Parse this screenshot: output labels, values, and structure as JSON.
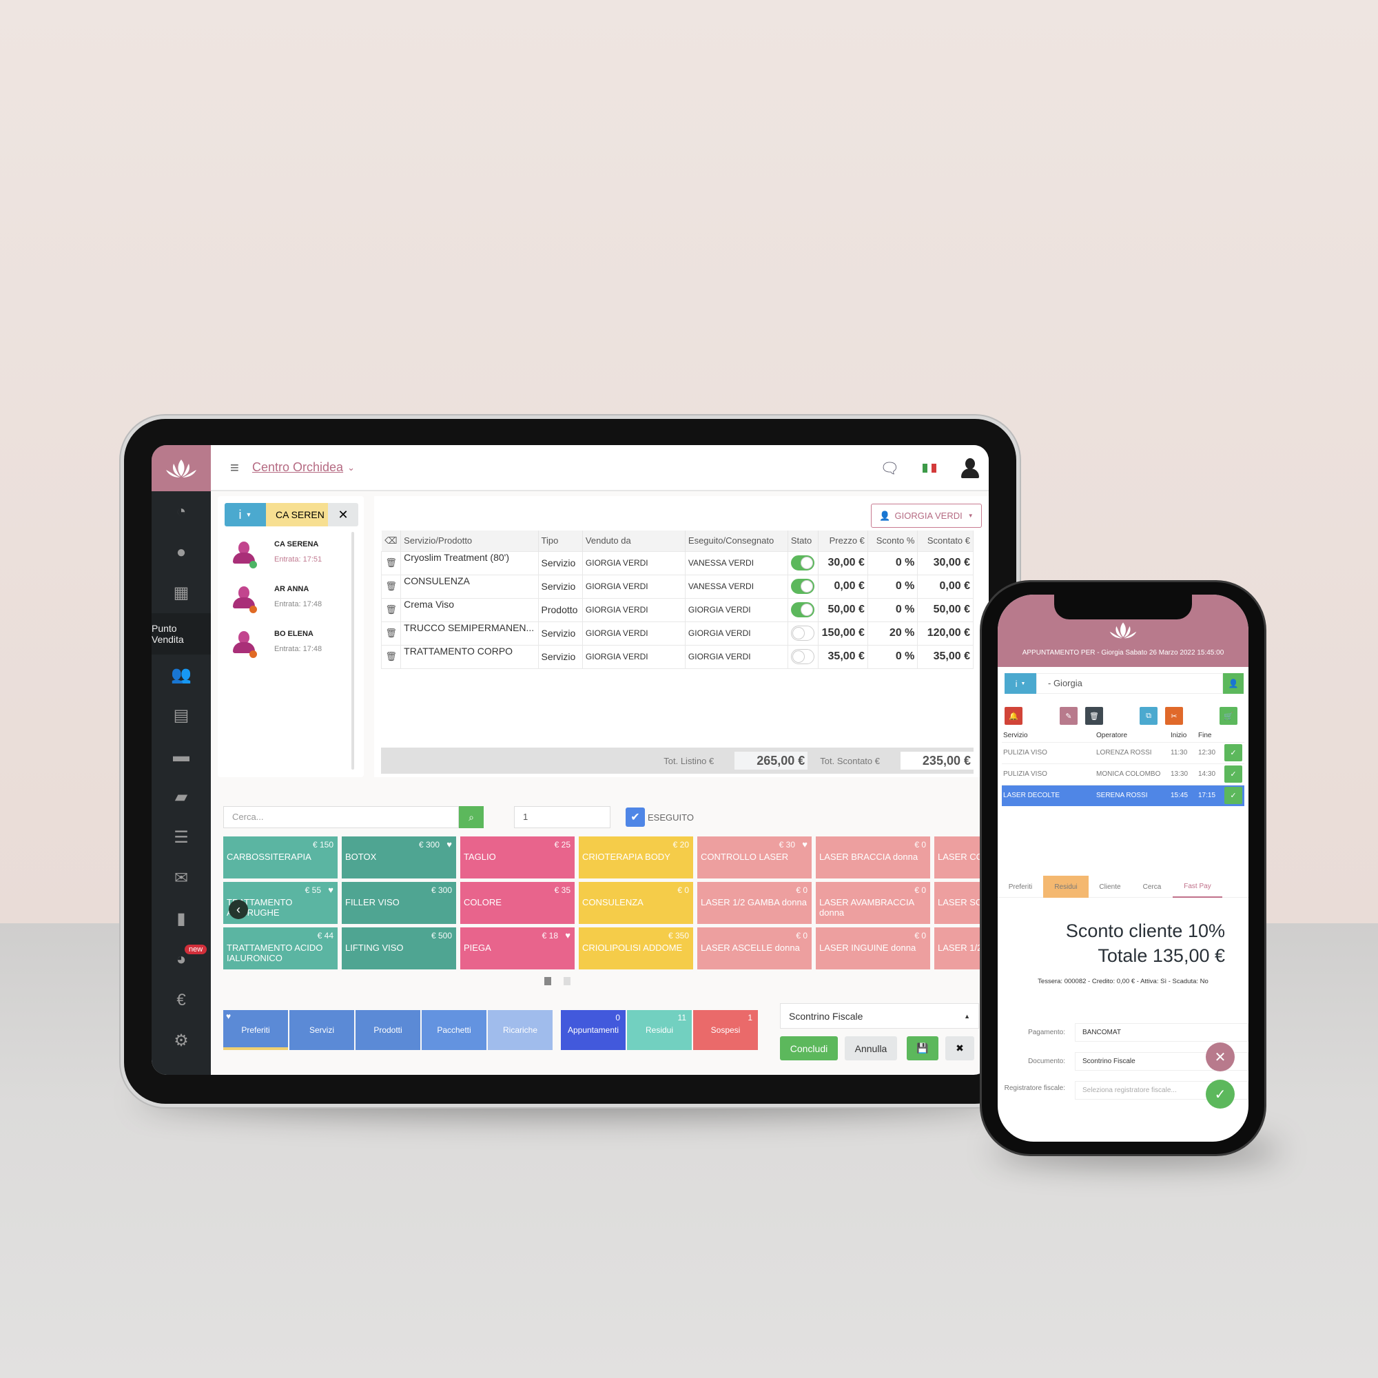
{
  "tablet": {
    "brand": "Centro Orchidea",
    "brand_color": "#b87a8c",
    "sidebar": {
      "items": [
        {
          "icon": "dashboard-icon"
        },
        {
          "icon": "user-icon"
        },
        {
          "icon": "calendar-icon"
        },
        {
          "label": "Punto Vendita",
          "active": true
        },
        {
          "icon": "users-icon"
        },
        {
          "icon": "id-card-icon"
        },
        {
          "icon": "archive-icon"
        },
        {
          "icon": "folder-icon"
        },
        {
          "icon": "list-icon"
        },
        {
          "icon": "envelope-icon"
        },
        {
          "icon": "bar-chart-icon"
        },
        {
          "icon": "pie-chart-icon",
          "badge": "new"
        },
        {
          "icon": "euro-icon"
        },
        {
          "icon": "gear-icon"
        }
      ]
    },
    "topbar": {
      "icons": [
        "chat-icon",
        "italy-flag-icon",
        "user-profile-icon"
      ]
    },
    "client_bar": {
      "info": "i",
      "name": "CA SEREN",
      "close": "✕"
    },
    "clients": [
      {
        "name": "CA SERENA",
        "entry": "Entrata: 17:51",
        "status": "green",
        "highlight": true
      },
      {
        "name": "AR ANNA",
        "entry": "Entrata: 17:48",
        "status": "orange"
      },
      {
        "name": "BO ELENA",
        "entry": "Entrata: 17:48",
        "status": "orange"
      }
    ],
    "operator_button": "GIORGIA VERDI",
    "table": {
      "headers": [
        "Servizio/Prodotto",
        "Tipo",
        "Venduto da",
        "Eseguito/Consegnato",
        "Stato",
        "Prezzo €",
        "Sconto %",
        "Scontato €"
      ],
      "rows": [
        {
          "name": "Cryoslim Treatment (80')",
          "type": "Servizio",
          "sold_by": "GIORGIA VERDI",
          "done_by": "VANESSA VERDI",
          "done": true,
          "price": "30,00 €",
          "discount": "0 %",
          "discounted": "30,00 €"
        },
        {
          "name": "CONSULENZA",
          "type": "Servizio",
          "sold_by": "GIORGIA VERDI",
          "done_by": "VANESSA VERDI",
          "done": true,
          "price": "0,00 €",
          "discount": "0 %",
          "discounted": "0,00 €"
        },
        {
          "name": "Crema Viso",
          "type": "Prodotto",
          "sold_by": "GIORGIA VERDI",
          "done_by": "GIORGIA VERDI",
          "done": true,
          "price": "50,00 €",
          "discount": "0 %",
          "discounted": "50,00 €"
        },
        {
          "name": "TRUCCO SEMIPERMANEN...",
          "type": "Servizio",
          "sold_by": "GIORGIA VERDI",
          "done_by": "GIORGIA VERDI",
          "done": false,
          "price": "150,00 €",
          "discount": "20 %",
          "discounted": "120,00 €"
        },
        {
          "name": "TRATTAMENTO CORPO",
          "type": "Servizio",
          "sold_by": "GIORGIA VERDI",
          "done_by": "GIORGIA VERDI",
          "done": false,
          "price": "35,00 €",
          "discount": "0 %",
          "discounted": "35,00 €"
        }
      ]
    },
    "totals": {
      "listino_label": "Tot. Listino €",
      "listino_value": "265,00 €",
      "scontato_label": "Tot. Scontato €",
      "scontato_value": "235,00 €"
    },
    "search": {
      "placeholder": "Cerca...",
      "quantity": "1",
      "eseguito_label": "ESEGUITO",
      "eseguito_checked": true
    },
    "tiles": [
      {
        "label": "CARBOSSITERAPIA",
        "price": "€ 150",
        "fav": false,
        "color": "teal"
      },
      {
        "label": "BOTOX",
        "price": "€ 300",
        "fav": true,
        "color": "teal2"
      },
      {
        "label": "TAGLIO",
        "price": "€ 25",
        "fav": false,
        "color": "pink"
      },
      {
        "label": "CRIOTERAPIA BODY",
        "price": "€ 20",
        "fav": false,
        "color": "yellow"
      },
      {
        "label": "CONTROLLO LASER",
        "price": "€ 30",
        "fav": true,
        "color": "salmon"
      },
      {
        "label": "LASER BRACCIA donna",
        "price": "€ 0",
        "fav": false,
        "color": "salmon"
      },
      {
        "label": "LASER COS",
        "price": "",
        "fav": false,
        "color": "salmon"
      },
      {
        "label": "TRATTAMENTO ANTIRUGHE",
        "price": "€ 55",
        "fav": true,
        "color": "teal"
      },
      {
        "label": "FILLER VISO",
        "price": "€ 300",
        "fav": false,
        "color": "teal2"
      },
      {
        "label": "COLORE",
        "price": "€ 35",
        "fav": false,
        "color": "pink"
      },
      {
        "label": "CONSULENZA",
        "price": "€ 0",
        "fav": false,
        "color": "yellow"
      },
      {
        "label": "LASER 1/2 GAMBA donna",
        "price": "€ 0",
        "fav": false,
        "color": "salmon"
      },
      {
        "label": "LASER AVAMBRACCIA donna",
        "price": "€ 0",
        "fav": false,
        "color": "salmon"
      },
      {
        "label": "LASER SCH INFERIORE",
        "price": "",
        "fav": false,
        "color": "salmon"
      },
      {
        "label": "TRATTAMENTO ACIDO IALURONICO",
        "price": "€ 44",
        "fav": false,
        "color": "teal"
      },
      {
        "label": "LIFTING VISO",
        "price": "€ 500",
        "fav": false,
        "color": "teal2"
      },
      {
        "label": "PIEGA",
        "price": "€ 18",
        "fav": true,
        "color": "pink"
      },
      {
        "label": "CRIOLIPOLISI ADDOME",
        "price": "€ 350",
        "fav": false,
        "color": "yellow"
      },
      {
        "label": "LASER ASCELLE donna",
        "price": "€ 0",
        "fav": false,
        "color": "salmon"
      },
      {
        "label": "LASER INGUINE donna",
        "price": "€ 0",
        "fav": false,
        "color": "salmon"
      },
      {
        "label": "LASER 1/2",
        "price": "",
        "fav": false,
        "color": "salmon"
      }
    ],
    "pager": {
      "pages": 2,
      "current": 1
    },
    "categories": [
      {
        "label": "Preferiti",
        "color": "#5b8ad6",
        "selected": true,
        "heart": true
      },
      {
        "label": "Servizi",
        "color": "#5b8ad6"
      },
      {
        "label": "Prodotti",
        "color": "#5b8ad6"
      },
      {
        "label": "Pacchetti",
        "color": "#6393e0"
      },
      {
        "label": "Ricariche",
        "color": "#a0bcec"
      },
      {
        "label": "Appuntamenti",
        "color": "#4259dc",
        "count": "0"
      },
      {
        "label": "Residui",
        "color": "#72d0c0",
        "count": "11"
      },
      {
        "label": "Sospesi",
        "color": "#ea6a6a",
        "count": "1"
      }
    ],
    "document_select": "Scontrino Fiscale",
    "buttons": {
      "concludi": "Concludi",
      "annulla": "Annulla"
    }
  },
  "phone": {
    "header": "APPUNTAMENTO PER - Giorgia Sabato 26 Marzo 2022 15:45:00",
    "client_info": "i",
    "client_name": "- Giorgia",
    "table_headers": [
      "Servizio",
      "Operatore",
      "Inizio",
      "Fine"
    ],
    "appointments": [
      {
        "service": "PULIZIA VISO",
        "operator": "LORENZA ROSSI",
        "start": "11:30",
        "end": "12:30",
        "selected": false
      },
      {
        "service": "PULIZIA VISO",
        "operator": "MONICA COLOMBO",
        "start": "13:30",
        "end": "14:30",
        "selected": false
      },
      {
        "service": "LASER DECOLTE",
        "operator": "SERENA ROSSI",
        "start": "15:45",
        "end": "17:15",
        "selected": true
      }
    ],
    "tabs": [
      "Preferiti",
      "Residui",
      "Cliente",
      "Cerca",
      "Fast Pay"
    ],
    "active_tab": "Fast Pay",
    "summary": {
      "discount": "Sconto cliente  10%",
      "total": "Totale 135,00 €"
    },
    "tessera": "Tessera: 000082 - Credito: 0,00 € - Attiva: Sì - Scaduta: No",
    "form": {
      "pagamento_label": "Pagamento:",
      "pagamento_value": "BANCOMAT",
      "documento_label": "Documento:",
      "documento_value": "Scontrino Fiscale",
      "registratore_label": "Registratore fiscale:",
      "registratore_placeholder": "Seleziona registratore fiscale..."
    }
  }
}
